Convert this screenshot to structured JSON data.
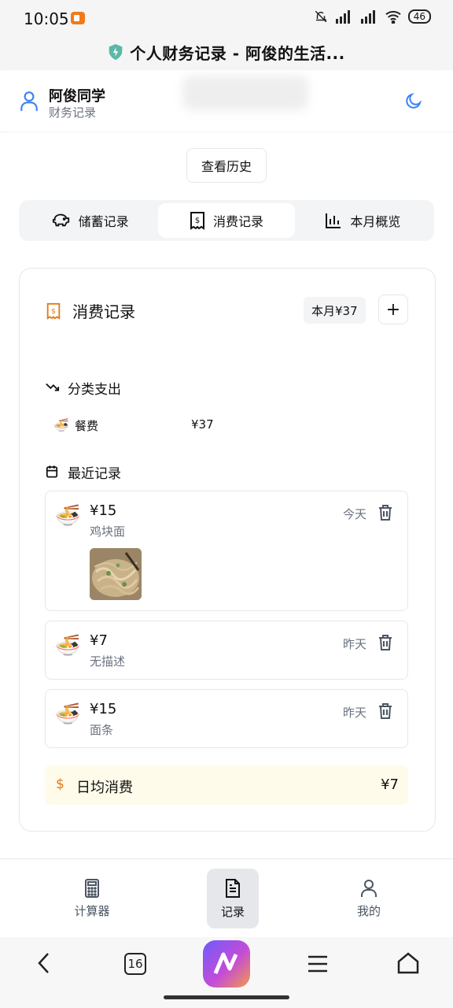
{
  "status_bar": {
    "time": "10:05",
    "battery": "46"
  },
  "browser": {
    "title": "个人财务记录 - 阿俊的生活..."
  },
  "header": {
    "username": "阿俊同学",
    "subtitle": "财务记录"
  },
  "history_button": "查看历史",
  "tabs": [
    {
      "label": "储蓄记录",
      "icon": "piggy-bank-icon",
      "active": false
    },
    {
      "label": "消费记录",
      "icon": "receipt-icon",
      "active": true
    },
    {
      "label": "本月概览",
      "icon": "bar-chart-icon",
      "active": false
    }
  ],
  "card": {
    "title": "消费记录",
    "month_badge": "本月¥37",
    "add_label": "+"
  },
  "category_section": {
    "title": "分类支出",
    "items": [
      {
        "emoji": "🍜",
        "name": "餐费",
        "amount": "¥37"
      }
    ]
  },
  "recent_section": {
    "title": "最近记录",
    "records": [
      {
        "emoji": "🍜",
        "amount": "¥15",
        "desc": "鸡块面",
        "date": "今天",
        "has_photo": true
      },
      {
        "emoji": "🍜",
        "amount": "¥7",
        "desc": "无描述",
        "date": "昨天",
        "has_photo": false
      },
      {
        "emoji": "🍜",
        "amount": "¥15",
        "desc": "面条",
        "date": "昨天",
        "has_photo": false
      }
    ]
  },
  "daily_average": {
    "icon": "$",
    "label": "日均消费",
    "value": "¥7"
  },
  "bottom_nav": [
    {
      "label": "计算器",
      "icon": "calculator-icon",
      "active": false
    },
    {
      "label": "记录",
      "icon": "document-icon",
      "active": true
    },
    {
      "label": "我的",
      "icon": "user-icon",
      "active": false
    }
  ],
  "system_nav": {
    "tab_count": "16"
  },
  "colors": {
    "accent_orange": "#e07a1a",
    "tab_bg": "#f3f4f6",
    "daily_bg": "#fffbeb"
  }
}
